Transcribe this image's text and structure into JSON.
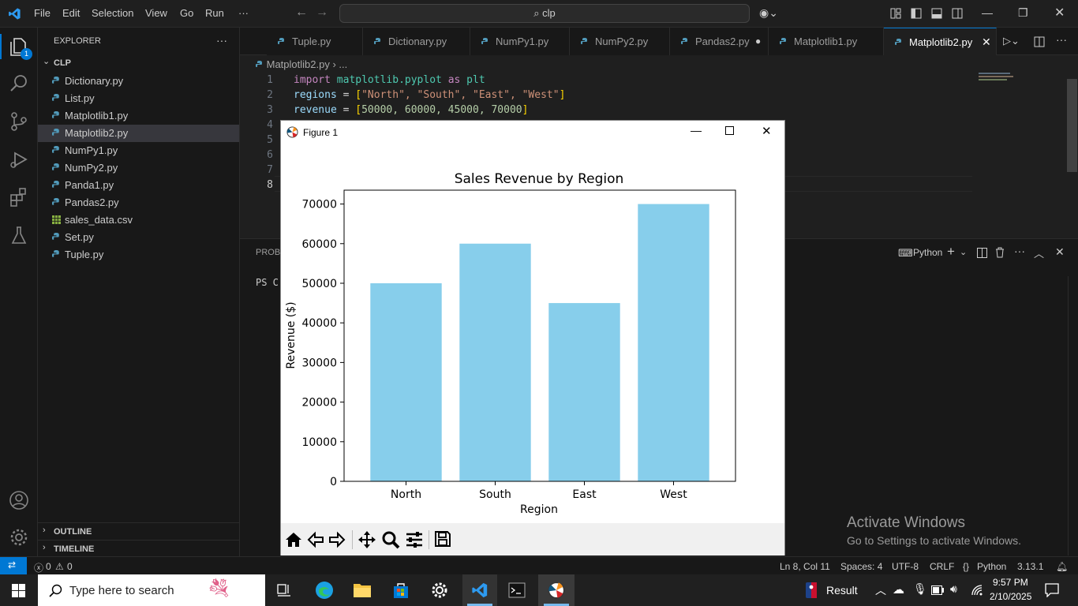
{
  "menu": {
    "items": [
      "File",
      "Edit",
      "Selection",
      "View",
      "Go",
      "Run",
      "···"
    ]
  },
  "search": {
    "text": "clp"
  },
  "explorer": {
    "header": "EXPLORER",
    "more": "···",
    "folder": "CLP",
    "files": [
      {
        "name": "Dictionary.py",
        "type": "py"
      },
      {
        "name": "List.py",
        "type": "py"
      },
      {
        "name": "Matplotlib1.py",
        "type": "py"
      },
      {
        "name": "Matplotlib2.py",
        "type": "py",
        "selected": true
      },
      {
        "name": "NumPy1.py",
        "type": "py"
      },
      {
        "name": "NumPy2.py",
        "type": "py"
      },
      {
        "name": "Panda1.py",
        "type": "py"
      },
      {
        "name": "Pandas2.py",
        "type": "py"
      },
      {
        "name": "sales_data.csv",
        "type": "csv"
      },
      {
        "name": "Set.py",
        "type": "py"
      },
      {
        "name": "Tuple.py",
        "type": "py"
      }
    ],
    "outline": "OUTLINE",
    "timeline": "TIMELINE",
    "badge": "1"
  },
  "tabs": [
    {
      "label": "Tuple.py"
    },
    {
      "label": "Dictionary.py"
    },
    {
      "label": "NumPy1.py"
    },
    {
      "label": "NumPy2.py"
    },
    {
      "label": "Pandas2.py",
      "modified": true
    },
    {
      "label": "Matplotlib1.py"
    },
    {
      "label": "Matplotlib2.py",
      "active": true
    }
  ],
  "breadcrumb": {
    "file": "Matplotlib2.py",
    "rest": "..."
  },
  "code": {
    "line_numbers": [
      "1",
      "2",
      "3",
      "4",
      "5",
      "6",
      "7",
      "8"
    ],
    "line1": {
      "kw1": "import",
      "mod": "matplotlib.pyplot",
      "kw2": "as",
      "alias": "plt"
    },
    "line2": {
      "var": "regions",
      "eq": " = ",
      "open": "[",
      "items": "\"North\", \"South\", \"East\", \"West\"",
      "close": "]"
    },
    "line3": {
      "var": "revenue",
      "eq": " = ",
      "open": "[",
      "items": "50000, 60000, 45000, 70000",
      "close": "]"
    }
  },
  "panel": {
    "tab_partial": "PROBL",
    "terminal_partial": "PS C",
    "terminal_name": "Python"
  },
  "figure": {
    "window_title": "Figure 1"
  },
  "chart_data": {
    "type": "bar",
    "title": "Sales Revenue by Region",
    "xlabel": "Region",
    "ylabel": "Revenue ($)",
    "categories": [
      "North",
      "South",
      "East",
      "West"
    ],
    "values": [
      50000,
      60000,
      45000,
      70000
    ],
    "ylim": [
      0,
      73500
    ],
    "yticks": [
      "0",
      "10000",
      "20000",
      "30000",
      "40000",
      "50000",
      "60000",
      "70000"
    ],
    "bar_color": "#87ceeb",
    "grid": false
  },
  "status": {
    "errors": "0",
    "warnings": "0",
    "position": "Ln 8, Col 11",
    "spaces": "Spaces: 4",
    "encoding": "UTF-8",
    "eol": "CRLF",
    "language": "Python",
    "version": "3.13.1"
  },
  "watermark": {
    "line1": "Activate Windows",
    "line2": "Go to Settings to activate Windows."
  },
  "taskbar": {
    "search_placeholder": "Type here to search",
    "result_label": "Result",
    "time": "9:57 PM",
    "date": "2/10/2025"
  },
  "colors": {
    "accent": "#0078d4",
    "bar": "#87ceeb"
  }
}
